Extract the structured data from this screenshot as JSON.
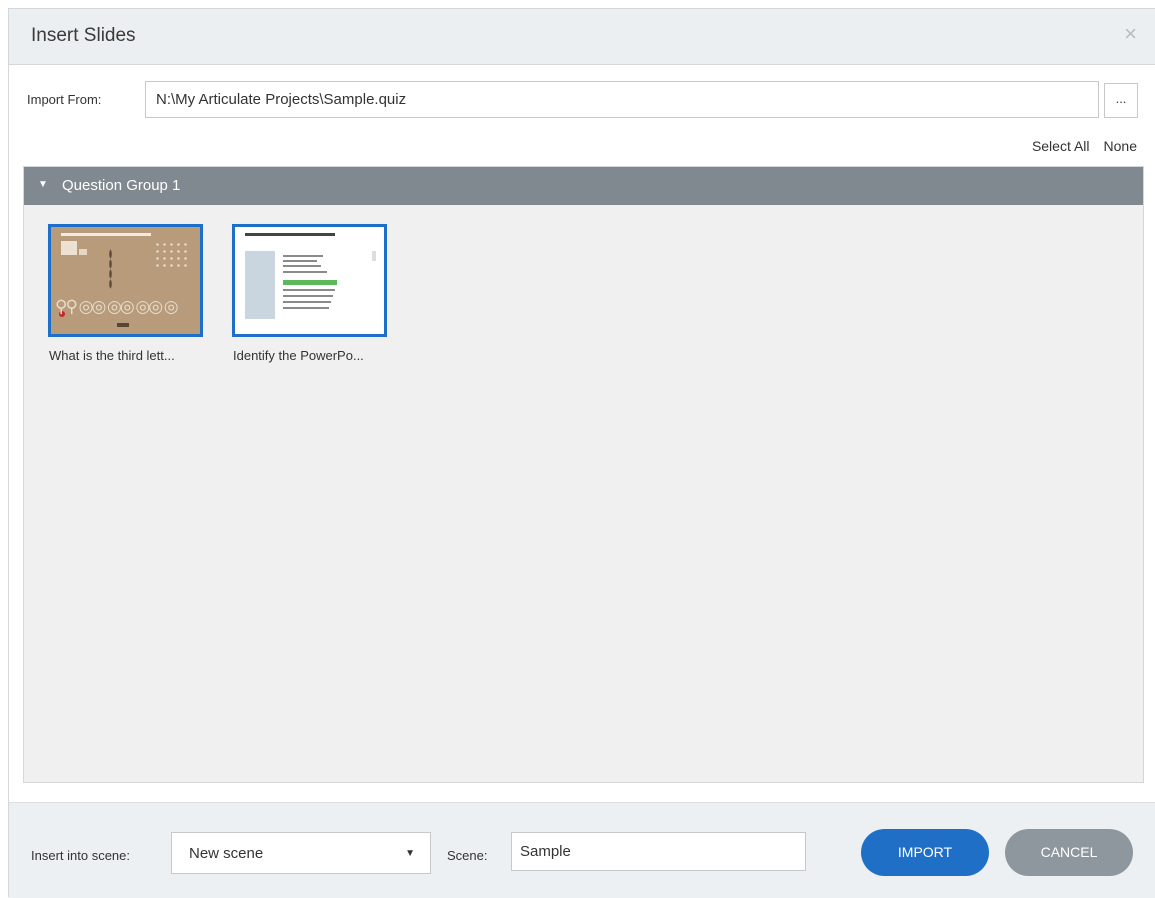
{
  "dialog": {
    "title": "Insert Slides",
    "close_glyph": "×"
  },
  "import_from": {
    "label": "Import From:",
    "value": "N:\\My Articulate Projects\\Sample.quiz",
    "browse_label": "..."
  },
  "selection": {
    "select_all": "Select All",
    "none": "None"
  },
  "group": {
    "label": "Question Group 1",
    "expanded": true,
    "slides": [
      {
        "caption": "What is the third lett...",
        "selected": true
      },
      {
        "caption": "Identify the PowerPo...",
        "selected": true
      }
    ]
  },
  "footer": {
    "insert_label": "Insert into scene:",
    "scene_option": "New scene",
    "scene_label": "Scene:",
    "scene_value": "Sample",
    "import_button": "IMPORT",
    "cancel_button": "CANCEL"
  },
  "colors": {
    "accent": "#1f6fc6",
    "group_header": "#808890",
    "cancel": "#8f979e"
  },
  "icons": {
    "close": "close-icon",
    "group_toggle": "triangle-down-icon",
    "dropdown": "caret-down-icon"
  }
}
